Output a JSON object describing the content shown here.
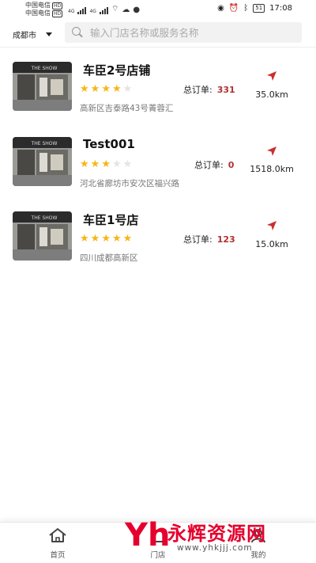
{
  "status_bar": {
    "carrier_1": "中国电信",
    "carrier_2": "中国电信",
    "hd_1": "HD",
    "hd_2": "HD",
    "net_1": "4G",
    "net_2": "4G",
    "battery": "51",
    "time": "17:08"
  },
  "header": {
    "city": "成都市",
    "search_placeholder": "输入门店名称或服务名称"
  },
  "orders_label": "总订单:",
  "stores": [
    {
      "name": "车臣2号店铺",
      "rating": 4,
      "orders": "331",
      "address": "高新区吉泰路43号菁蓉汇",
      "distance": "35.0km"
    },
    {
      "name": "Test001",
      "rating": 3,
      "orders": "0",
      "address": "河北省廊坊市安次区福兴路",
      "distance": "1518.0km"
    },
    {
      "name": "车臣1号店",
      "rating": 5,
      "orders": "123",
      "address": "四川成都高新区",
      "distance": "15.0km"
    }
  ],
  "bottom_nav": {
    "home_label": "首页",
    "stores_label": "门店",
    "mine_label": "我的"
  },
  "watermark": {
    "logo": "Yh",
    "title": "永辉资源网",
    "url": "www.yhkjjj.com"
  },
  "colors": {
    "star_on": "#f6b614",
    "star_off": "#e4e4e4",
    "order_value": "#b03030",
    "nav_arrow": "#c9302c",
    "watermark": "#e5002d"
  }
}
